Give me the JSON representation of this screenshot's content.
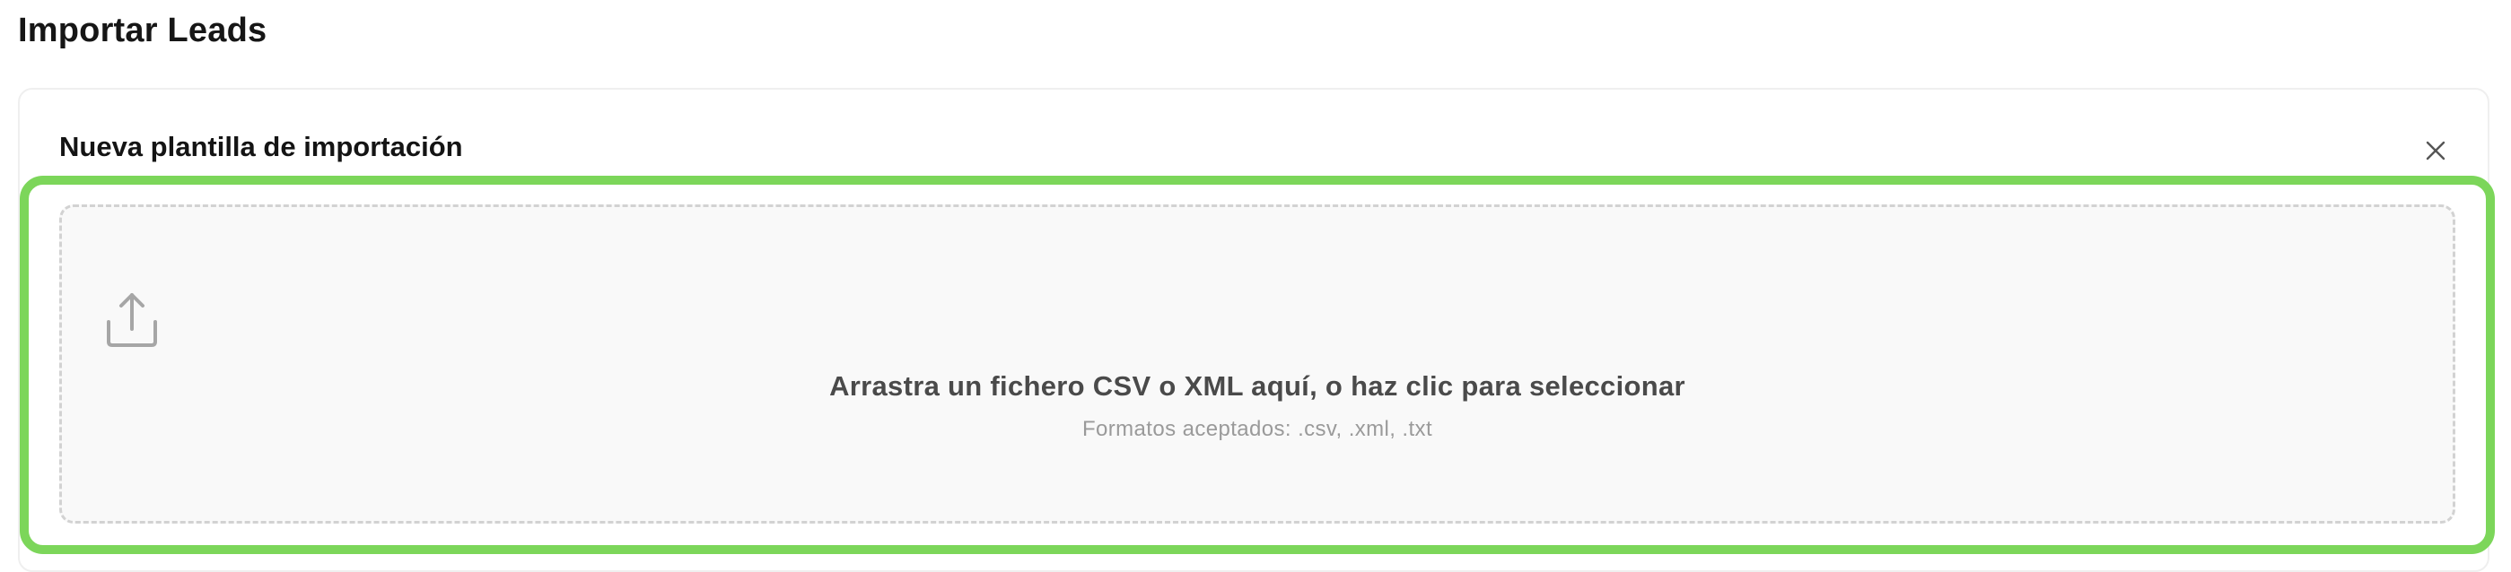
{
  "page": {
    "title": "Importar Leads"
  },
  "card": {
    "title": "Nueva plantilla de importación",
    "close_icon": "close-icon"
  },
  "dropzone": {
    "icon": "upload-icon",
    "main_text": "Arrastra un fichero CSV o XML aquí, o haz clic para seleccionar",
    "formats_text": "Formatos aceptados: .csv, .xml, .txt"
  },
  "colors": {
    "highlight": "#7cd65a",
    "dropzone_bg": "#f9f9f9",
    "dropzone_border": "#d2d2d2",
    "text_primary": "#161616",
    "text_secondary": "#4a4a4a",
    "text_muted": "#9a9a9a"
  }
}
